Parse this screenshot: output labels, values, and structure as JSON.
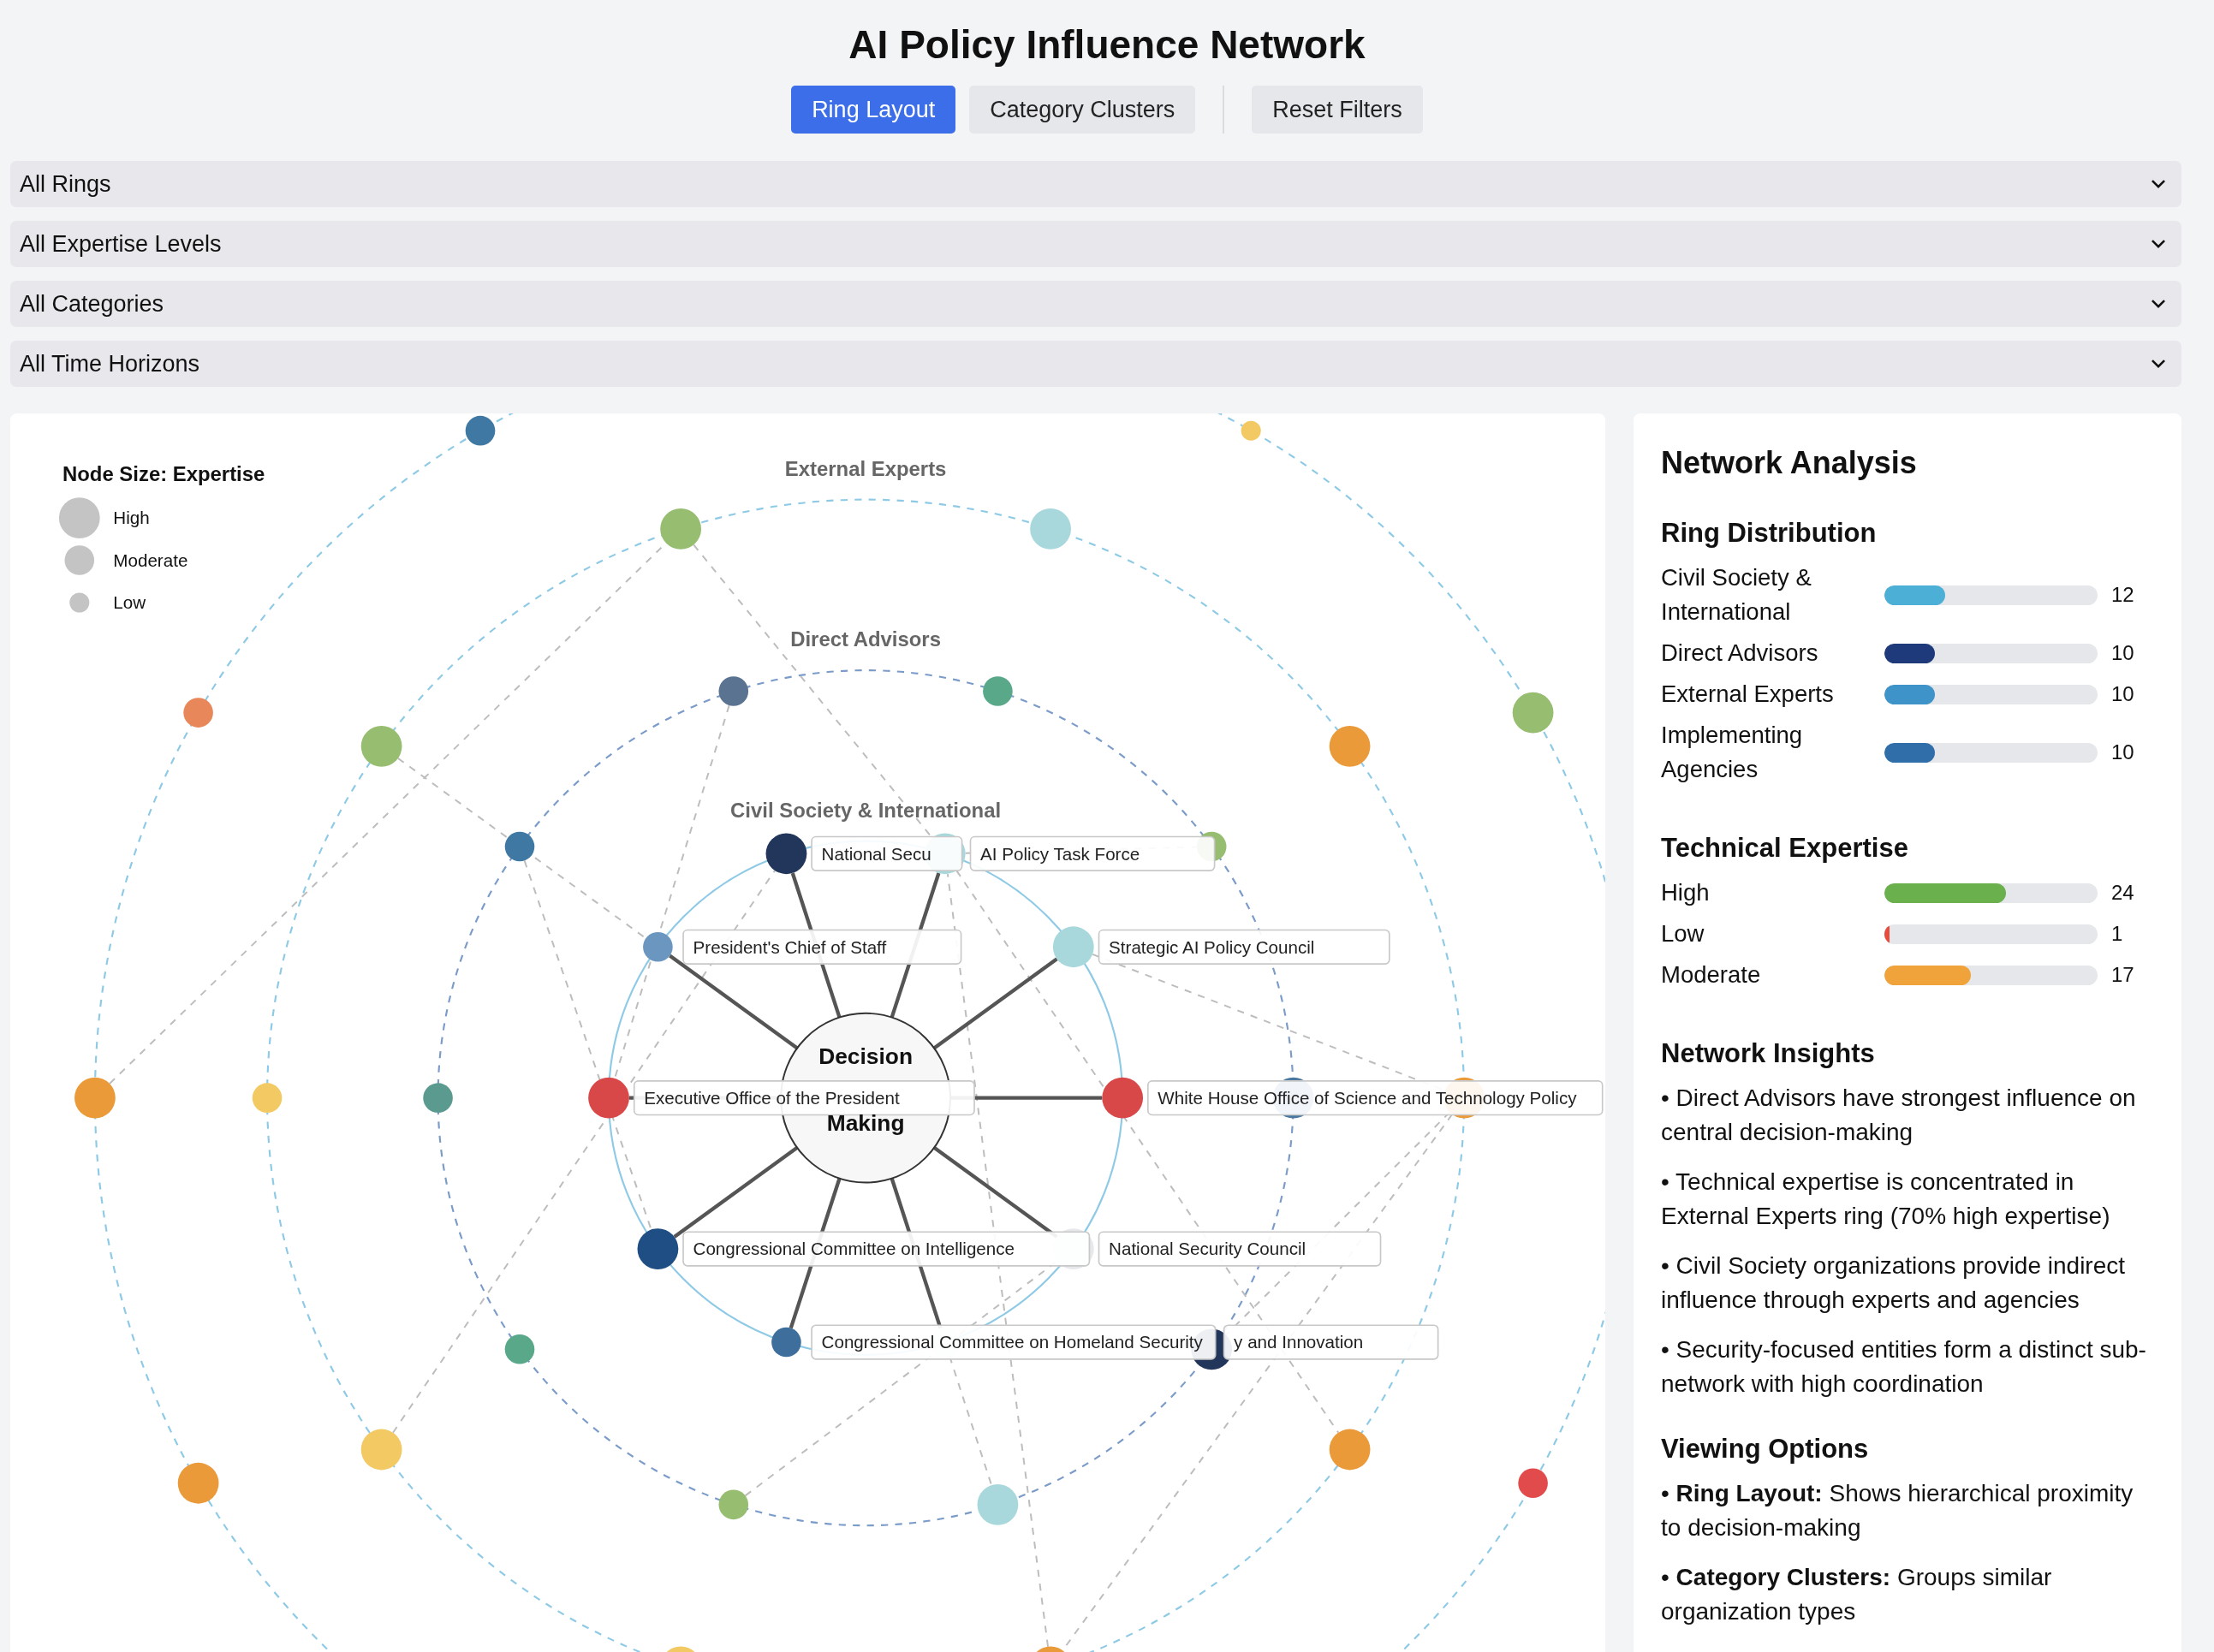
{
  "title": "AI Policy Influence Network",
  "toolbar": {
    "modes": [
      {
        "label": "Ring Layout",
        "selected": true
      },
      {
        "label": "Category Clusters",
        "selected": false
      }
    ],
    "reset": {
      "label": "Reset Filters"
    }
  },
  "filters": [
    {
      "value": "All Rings"
    },
    {
      "value": "All Expertise Levels"
    },
    {
      "value": "All Categories"
    },
    {
      "value": "All Time Horizons"
    }
  ],
  "network": {
    "legend": {
      "title": "Node Size: Expertise",
      "items": [
        {
          "label": "High",
          "kind": "high"
        },
        {
          "label": "Moderate",
          "kind": "moderate"
        },
        {
          "label": "Low",
          "kind": "low"
        }
      ]
    },
    "rings": [
      {
        "nodes": [
          {
            "color": "#f2c963",
            "kind": "low"
          },
          {
            "color": "#97bd70",
            "kind": "high"
          },
          {
            "color": "#e24b4b",
            "kind": "moderate"
          },
          {
            "color": "#eb9a3a",
            "kind": "high"
          },
          {
            "color": "#eb9a3a",
            "kind": "high"
          },
          {
            "color": "#e8885a",
            "kind": "moderate"
          },
          {
            "color": "#3f79a3",
            "kind": "moderate"
          }
        ]
      },
      {
        "label": "External Experts",
        "nodes": [
          {
            "color": "#a8d8dc",
            "kind": "high"
          },
          {
            "color": "#eb9a3a",
            "kind": "high"
          },
          {
            "color": "#eb9a3a",
            "kind": "high"
          },
          {
            "color": "#eb9a3a",
            "kind": "high"
          },
          {
            "color": "#eb9a3a",
            "kind": "high"
          },
          {
            "color": "#f2c963",
            "kind": "high"
          },
          {
            "color": "#f2c963",
            "kind": "high"
          },
          {
            "color": "#f2c963",
            "kind": "moderate"
          },
          {
            "color": "#97bd70",
            "kind": "high"
          },
          {
            "color": "#97bd70",
            "kind": "high"
          }
        ]
      },
      {
        "label": "Direct Advisors",
        "nodes": [
          {
            "color": "#5aa88a",
            "kind": "moderate"
          },
          {
            "color": "#97bd70",
            "kind": "moderate"
          },
          {
            "color": "#4a78a0",
            "kind": "high"
          },
          {
            "color": "#22365c",
            "kind": "high"
          },
          {
            "color": "#a8d8dc",
            "kind": "high"
          },
          {
            "color": "#97bd70",
            "kind": "moderate"
          },
          {
            "color": "#5aa88a",
            "kind": "moderate"
          },
          {
            "color": "#5a9a8f",
            "kind": "moderate"
          },
          {
            "color": "#3f79a3",
            "kind": "moderate"
          },
          {
            "color": "#5a7391",
            "kind": "moderate"
          }
        ]
      },
      {
        "label": "Civil Society & International",
        "nodes": [
          {
            "color": "#22365c",
            "kind": "high",
            "label": "National Secu"
          },
          {
            "color": "#a8d8dc",
            "kind": "high",
            "label": "AI Policy Task Force"
          },
          {
            "color": "#6b96c0",
            "kind": "moderate",
            "label": "President's Chief of Staff"
          },
          {
            "color": "#a8d8dc",
            "kind": "high",
            "label": "Strategic AI Policy Council"
          },
          {
            "color": "#d94848",
            "kind": "high",
            "label": "Executive Office of the President"
          },
          {
            "color": "#d94848",
            "kind": "high",
            "label": "White House Office of Science and Technology Policy"
          },
          {
            "color": "#1f4e85",
            "kind": "high",
            "label": "Congressional Committee on Intelligence"
          },
          {
            "color": "#e6e8ec",
            "kind": "high",
            "label": "National Security Council"
          },
          {
            "color": "#3d6e9c",
            "kind": "moderate",
            "label": "Congressional Committee on Homeland Security"
          },
          {
            "color": "#e6e8ec",
            "kind": "moderate",
            "label": "y and Innovation"
          }
        ]
      }
    ],
    "center": {
      "lines": [
        "Decision",
        "Making"
      ]
    }
  },
  "panel": {
    "title": "Network Analysis",
    "sections": [
      {
        "kind": "bars",
        "heading": "Ring Distribution",
        "rows": [
          {
            "label": "Civil Society & International",
            "level": 0.286,
            "count": "12",
            "color": "#4bafd6"
          },
          {
            "label": "Direct Advisors",
            "level": 0.238,
            "count": "10",
            "color": "#1e3a7b"
          },
          {
            "label": "External Experts",
            "level": 0.238,
            "count": "10",
            "color": "#3e93c9"
          },
          {
            "label": "Implementing Agencies",
            "level": 0.238,
            "count": "10",
            "color": "#2f6ea8"
          }
        ]
      },
      {
        "kind": "bars",
        "heading": "Technical Expertise",
        "rows": [
          {
            "label": "High",
            "level": 0.571,
            "count": "24",
            "color": "#6ab04c"
          },
          {
            "label": "Low",
            "level": 0.024,
            "count": "1",
            "color": "#e74c3c"
          },
          {
            "label": "Moderate",
            "level": 0.405,
            "count": "17",
            "color": "#f0a33a"
          }
        ]
      },
      {
        "kind": "bullets",
        "heading": "Network Insights",
        "items": [
          "• Direct Advisors have strongest influence on central decision-making",
          "• Technical expertise is concentrated in External Experts ring (70% high expertise)",
          "• Civil Society organizations provide indirect influence through experts and agencies",
          "• Security-focused entities form a distinct sub-network with high coordination"
        ]
      },
      {
        "kind": "bullets",
        "heading": "Viewing Options",
        "items": [
          "• **Ring Layout:** Shows hierarchical proximity to decision-making",
          "• **Category Clusters:** Groups similar organization types"
        ]
      }
    ]
  }
}
